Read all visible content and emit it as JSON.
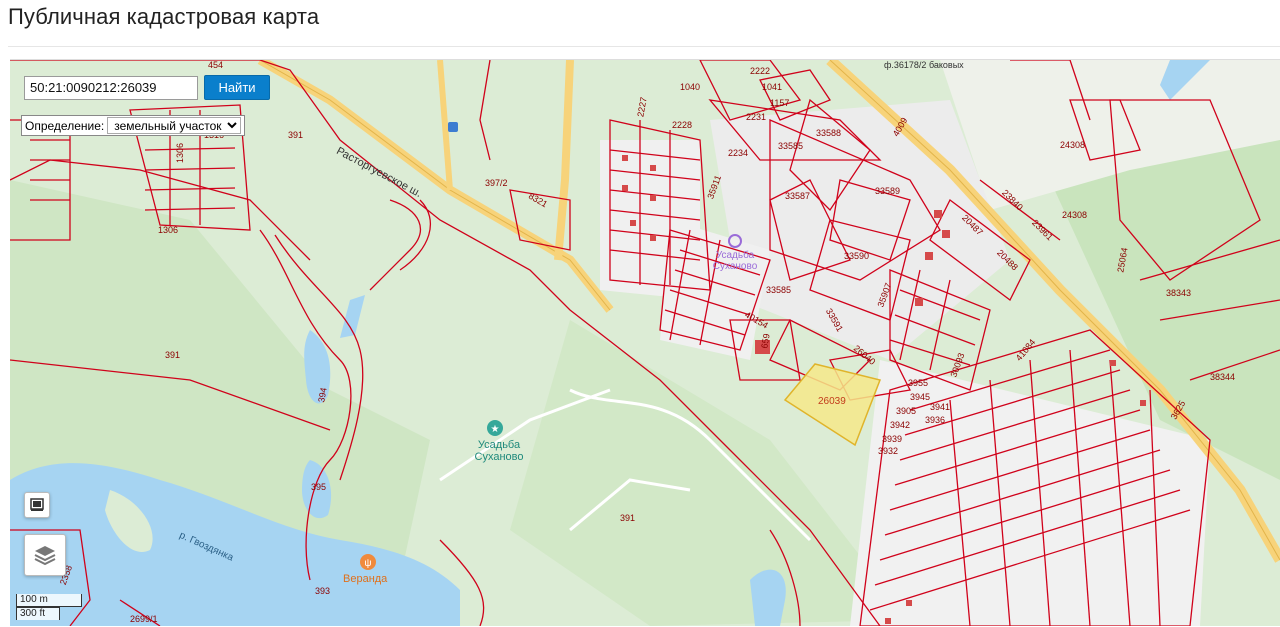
{
  "page": {
    "title": "Публичная кадастровая карта"
  },
  "search": {
    "value": "50:21:0090212:26039",
    "button_label": "Найти"
  },
  "definition": {
    "label": "Определение:",
    "selected": "земельный участок"
  },
  "scale": {
    "metric": "100 m",
    "imperial": "300 ft"
  },
  "map": {
    "road_label": "Расторгуевское ш.",
    "river_label": "р. Гвоздянка",
    "poi": [
      {
        "name": "Усадьба\nСуханово",
        "line1": "Усадьба",
        "line2": "Суханово",
        "icon": "star-pin-icon"
      },
      {
        "name": "Веранда",
        "icon": "restaurant-pin-icon"
      },
      {
        "line1": "Усадьба",
        "line2": "Суханово",
        "icon": "star-pin-icon"
      }
    ],
    "highlighted_parcel": "26039",
    "parcel_labels": [
      "391",
      "391",
      "391",
      "391",
      "394",
      "395",
      "393",
      "397/2",
      "8321",
      "2227",
      "2228",
      "1040",
      "1041",
      "1157",
      "2222",
      "2231",
      "2234",
      "33588",
      "33585",
      "33587",
      "33589",
      "33590",
      "33585",
      "35911",
      "35907",
      "33591",
      "26040",
      "40154",
      "659",
      "24308",
      "24308",
      "23840",
      "23961",
      "20487",
      "20488",
      "25064",
      "38343",
      "38344",
      "4009",
      "3625",
      "41084",
      "30093",
      "3955",
      "3945",
      "3905",
      "3936",
      "3941",
      "3942",
      "3939",
      "3932",
      "1306",
      "1306",
      "1316",
      "454",
      "2358",
      "2699/1",
      "ф.36178/2 баковых"
    ],
    "colors": {
      "parcel_border": "#d0021b",
      "highlight_fill": "#f6e98a",
      "highlight_border": "#e0b42a",
      "water": "#a6d4f2",
      "forest": "#cfe6c4",
      "road": "#f7d37a"
    }
  }
}
